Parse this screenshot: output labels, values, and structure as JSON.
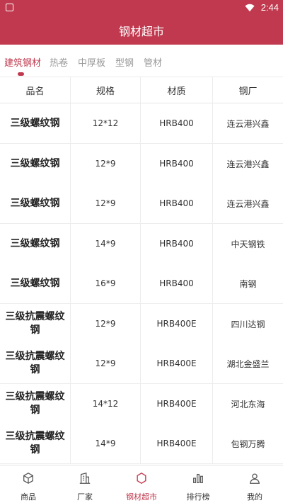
{
  "status_bar": {
    "time": "2:44"
  },
  "app_bar": {
    "title": "钢材超市"
  },
  "tabs": [
    {
      "label": "建筑钢材",
      "active": true
    },
    {
      "label": "热卷",
      "active": false
    },
    {
      "label": "中厚板",
      "active": false
    },
    {
      "label": "型钢",
      "active": false
    },
    {
      "label": "管材",
      "active": false
    }
  ],
  "table": {
    "headers": [
      "品名",
      "规格",
      "材质",
      "钢厂"
    ],
    "rows": [
      [
        "三级螺纹钢",
        "12*12",
        "HRB400",
        "连云港兴鑫"
      ],
      [
        "三级螺纹钢",
        "12*9",
        "HRB400",
        "连云港兴鑫"
      ],
      [
        "三级螺纹钢",
        "12*9",
        "HRB400",
        "连云港兴鑫"
      ],
      [
        "三级螺纹钢",
        "14*9",
        "HRB400",
        "中天钢铁"
      ],
      [
        "三级螺纹钢",
        "16*9",
        "HRB400",
        "南钢"
      ],
      [
        "三级抗震螺纹钢",
        "12*9",
        "HRB400E",
        "四川达钢"
      ],
      [
        "三级抗震螺纹钢",
        "12*9",
        "HRB400E",
        "湖北金盛兰"
      ],
      [
        "三级抗震螺纹钢",
        "14*12",
        "HRB400E",
        "河北东海"
      ],
      [
        "三级抗震螺纹钢",
        "14*9",
        "HRB400E",
        "包钢万腾"
      ]
    ]
  },
  "bottom_nav": [
    {
      "label": "商品",
      "icon": "cube-icon",
      "active": false
    },
    {
      "label": "厂家",
      "icon": "building-icon",
      "active": false
    },
    {
      "label": "钢材超市",
      "icon": "hexagon-icon",
      "active": true
    },
    {
      "label": "排行榜",
      "icon": "bar-chart-icon",
      "active": false
    },
    {
      "label": "我的",
      "icon": "user-icon",
      "active": false
    }
  ],
  "colors": {
    "accent": "#c0394e",
    "text": "#333333",
    "muted": "#999999"
  }
}
